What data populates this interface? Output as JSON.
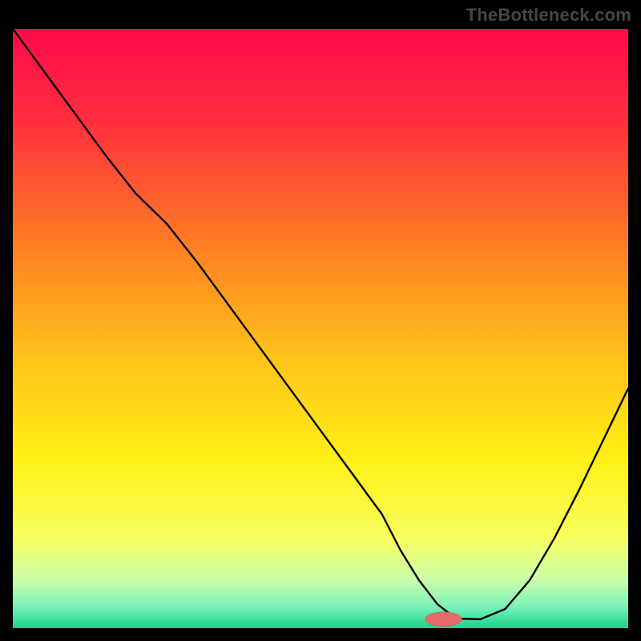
{
  "watermark": "TheBottleneck.com",
  "colors": {
    "frame_bg": "#000000",
    "watermark_text": "#464646",
    "gradient_stops": [
      {
        "offset": 0.0,
        "color": "#ff0a4a"
      },
      {
        "offset": 0.15,
        "color": "#ff2d3f"
      },
      {
        "offset": 0.35,
        "color": "#ff7a24"
      },
      {
        "offset": 0.55,
        "color": "#ffc31a"
      },
      {
        "offset": 0.72,
        "color": "#fff016"
      },
      {
        "offset": 0.85,
        "color": "#f7ff60"
      },
      {
        "offset": 0.92,
        "color": "#c9ffab"
      },
      {
        "offset": 0.965,
        "color": "#7af0b9"
      },
      {
        "offset": 1.0,
        "color": "#19d38b"
      }
    ],
    "curve_stroke": "#000000",
    "marker_fill": "#e46b6b",
    "marker_stroke": "#c74e4e"
  },
  "chart_data": {
    "type": "line",
    "title": "",
    "xlabel": "",
    "ylabel": "",
    "xlim": [
      0,
      100
    ],
    "ylim": [
      0,
      100
    ],
    "grid": false,
    "legend": false,
    "series": [
      {
        "name": "bottleneck-curve",
        "x": [
          0,
          5,
          10,
          15,
          20,
          25,
          30,
          35,
          40,
          45,
          50,
          55,
          60,
          63,
          66,
          69,
          72,
          76,
          80,
          84,
          88,
          92,
          96,
          100
        ],
        "y": [
          100,
          93,
          86,
          79,
          72.5,
          67.5,
          61,
          54,
          47,
          40,
          33,
          26,
          19,
          13,
          8,
          4,
          1.6,
          1.5,
          3.2,
          8,
          15,
          23,
          31.5,
          40
        ]
      }
    ],
    "marker": {
      "x": 70,
      "y": 1.5,
      "rx": 3.0,
      "ry": 1.2
    },
    "notes": "x and y are percentages of the plot area; (0,0) is bottom-left, (100,100) top-left of the colored square."
  }
}
